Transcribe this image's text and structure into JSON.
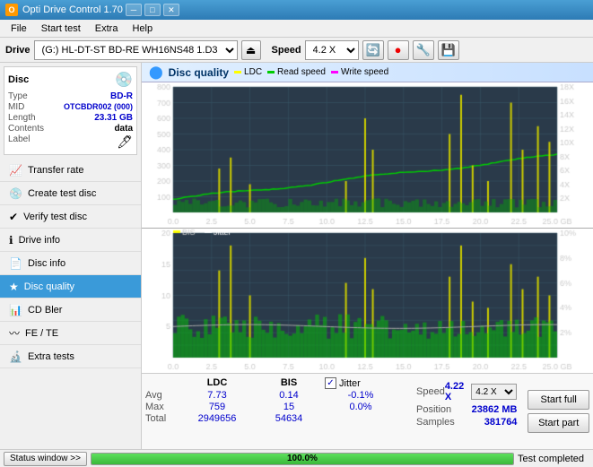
{
  "titlebar": {
    "title": "Opti Drive Control 1.70",
    "min_btn": "─",
    "max_btn": "□",
    "close_btn": "✕"
  },
  "menubar": {
    "items": [
      "File",
      "Start test",
      "Extra",
      "Help"
    ]
  },
  "drivebar": {
    "label": "Drive",
    "drive_value": "(G:)  HL-DT-ST BD-RE  WH16NS48 1.D3",
    "speed_label": "Speed",
    "speed_value": "4.2 X"
  },
  "disc": {
    "header": "Disc",
    "type_label": "Type",
    "type_value": "BD-R",
    "mid_label": "MID",
    "mid_value": "OTCBDR002 (000)",
    "length_label": "Length",
    "length_value": "23.31 GB",
    "contents_label": "Contents",
    "contents_value": "data",
    "label_label": "Label",
    "label_value": ""
  },
  "nav": {
    "items": [
      {
        "label": "Transfer rate",
        "icon": "📈",
        "active": false
      },
      {
        "label": "Create test disc",
        "icon": "💿",
        "active": false
      },
      {
        "label": "Verify test disc",
        "icon": "✔",
        "active": false
      },
      {
        "label": "Drive info",
        "icon": "ℹ",
        "active": false
      },
      {
        "label": "Disc info",
        "icon": "📄",
        "active": false
      },
      {
        "label": "Disc quality",
        "icon": "★",
        "active": true
      },
      {
        "label": "CD Bler",
        "icon": "📊",
        "active": false
      },
      {
        "label": "FE / TE",
        "icon": "〰",
        "active": false
      },
      {
        "label": "Extra tests",
        "icon": "🔬",
        "active": false
      }
    ]
  },
  "content": {
    "title": "Disc quality",
    "legend": [
      {
        "label": "LDC",
        "color": "#ffff00"
      },
      {
        "label": "Read speed",
        "color": "#00cc00"
      },
      {
        "label": "Write speed",
        "color": "#ff00ff"
      }
    ],
    "chart_top": {
      "y_max": 800,
      "y_right_labels": [
        "18X",
        "16X",
        "14X",
        "12X",
        "10X",
        "8X",
        "6X",
        "4X",
        "2X"
      ],
      "x_labels": [
        "0.0",
        "2.5",
        "5.0",
        "7.5",
        "10.0",
        "12.5",
        "15.0",
        "17.5",
        "20.0",
        "22.5",
        "25.0 GB"
      ]
    },
    "chart_bottom": {
      "y_max": 20,
      "y_right_labels": [
        "10%",
        "8%",
        "6%",
        "4%",
        "2%"
      ],
      "legend": [
        {
          "label": "BIS",
          "color": "#ffff00"
        },
        {
          "label": "Jitter",
          "color": "#ffffff"
        }
      ],
      "x_labels": [
        "0.0",
        "2.5",
        "5.0",
        "7.5",
        "10.0",
        "12.5",
        "15.0",
        "17.5",
        "20.0",
        "22.5",
        "25.0 GB"
      ]
    }
  },
  "stats": {
    "headers": [
      "LDC",
      "BIS",
      "",
      "Jitter"
    ],
    "rows": [
      {
        "label": "Avg",
        "ldc": "7.73",
        "bis": "0.14",
        "jitter": "-0.1%"
      },
      {
        "label": "Max",
        "ldc": "759",
        "bis": "15",
        "jitter": "0.0%"
      },
      {
        "label": "Total",
        "ldc": "2949656",
        "bis": "54634",
        "jitter": ""
      }
    ],
    "speed": {
      "speed_label": "Speed",
      "speed_value": "4.22 X",
      "speed_select": "4.2 X",
      "position_label": "Position",
      "position_value": "23862 MB",
      "samples_label": "Samples",
      "samples_value": "381764"
    },
    "buttons": {
      "start_full": "Start full",
      "start_part": "Start part"
    },
    "jitter_checked": true,
    "jitter_label": "Jitter"
  },
  "statusbar": {
    "window_btn": "Status window >>",
    "progress": 100.0,
    "progress_text": "100.0%",
    "status_text": "Test completed"
  }
}
